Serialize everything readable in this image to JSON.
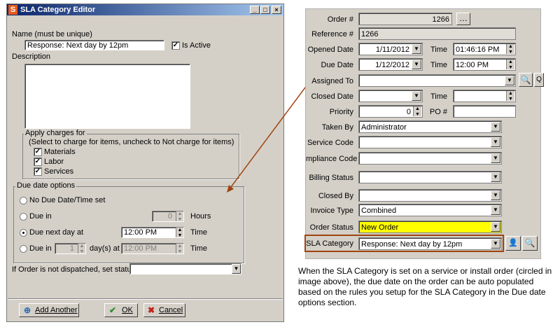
{
  "dialog": {
    "title": "SLA Category Editor",
    "name_label": "Name (must be unique)",
    "name_value": "Response: Next day by 12pm",
    "is_active_label": "Is Active",
    "description_label": "Description",
    "charges": {
      "title": "Apply charges for",
      "hint": "(Select to charge for items, uncheck to Not charge for items)",
      "items": [
        {
          "label": "Materials",
          "checked": true
        },
        {
          "label": "Labor",
          "checked": true
        },
        {
          "label": "Services",
          "checked": true
        }
      ]
    },
    "due_options": {
      "title": "Due date options",
      "no_due": "No Due Date/Time set",
      "due_in": "Due in",
      "due_in_value": "0",
      "hours": "Hours",
      "due_next_day": "Due next day at",
      "next_day_time": "12:00 PM",
      "time": "Time",
      "due_in2": "Due in",
      "days_value": "1",
      "days_at": "day(s) at",
      "days_time": "12:00 PM",
      "time2": "Time",
      "selected": "due_next_day"
    },
    "not_dispatched_label": "If Order is not dispatched, set status",
    "not_dispatched_value": "",
    "buttons": {
      "add_another": "Add Another",
      "ok": "OK",
      "cancel": "Cancel"
    }
  },
  "order_form": {
    "order_label": "Order #",
    "order_value": "1266",
    "reference_label": "Reference #",
    "reference_value": "1266",
    "opened_label": "Opened Date",
    "opened_date": "1/11/2012",
    "opened_time_label": "Time",
    "opened_time": "01:46:16 PM",
    "due_label": "Due Date",
    "due_date": "1/12/2012",
    "due_time_label": "Time",
    "due_time": "12:00 PM",
    "assigned_label": "Assigned To",
    "assigned_value": "",
    "q_label": "Q",
    "closed_label": "Closed Date",
    "closed_date": "",
    "closed_time_label": "Time",
    "closed_time": "",
    "priority_label": "Priority",
    "priority_value": "0",
    "po_label": "PO #",
    "po_value": "",
    "taken_by_label": "Taken By",
    "taken_by_value": "Administrator",
    "service_code_label": "Service Code",
    "service_code_value": "",
    "compliance_label": "mpliance Code",
    "compliance_value": "",
    "billing_label": "Billing Status",
    "billing_value": "",
    "closed_by_label": "Closed By",
    "closed_by_value": "",
    "invoice_label": "Invoice Type",
    "invoice_value": "Combined",
    "status_label": "Order Status",
    "status_value": "New Order",
    "sla_label": "SLA Category",
    "sla_value": "Response: Next day by 12pm"
  },
  "caption": "When the SLA Category is set on a service or install order (circled in image above), the due date on the order can be auto populated based on the rules you setup for the SLA Category in the Due date options section.",
  "colors": {
    "status_highlight": "#ffff00",
    "sla_circle": "#a0440f",
    "arrow": "#a0440f",
    "titlebar": "#0a246a"
  },
  "icons": [
    "app-icon",
    "minimize-icon",
    "maximize-icon",
    "close-icon",
    "add-icon",
    "checkmark-icon",
    "cancel-x-icon",
    "magnifier-icon",
    "ellipsis-icon",
    "user-key-icon"
  ]
}
